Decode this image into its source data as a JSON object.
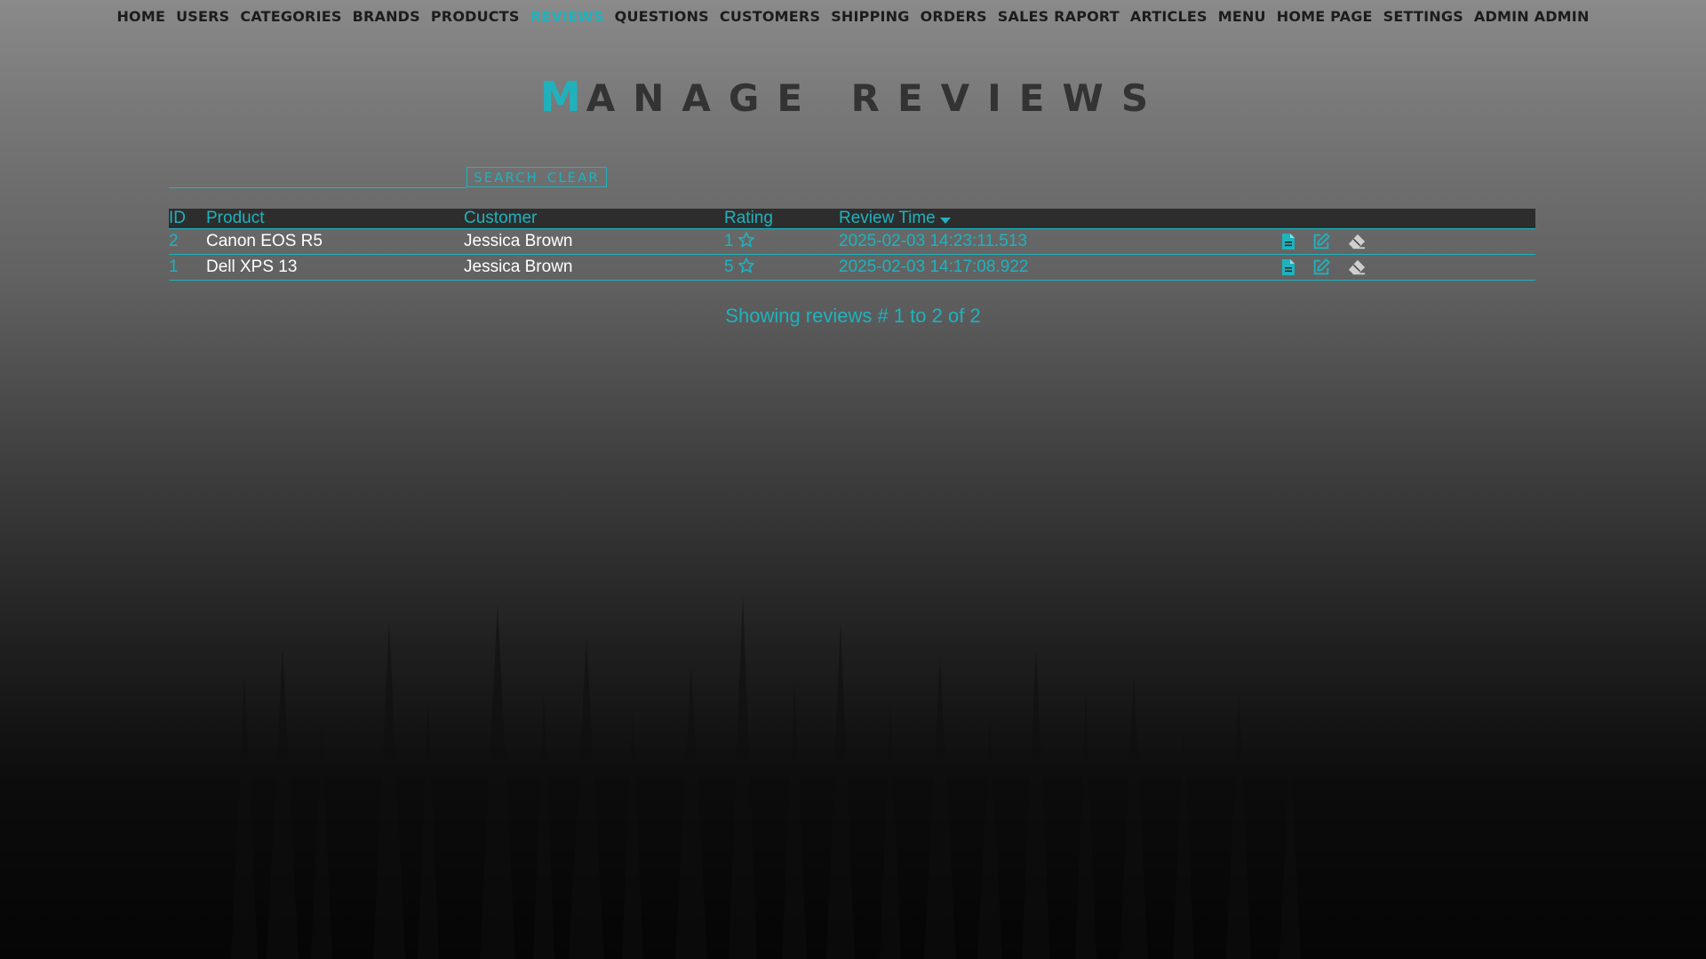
{
  "nav": {
    "items": [
      {
        "label": "HOME"
      },
      {
        "label": "USERS"
      },
      {
        "label": "CATEGORIES"
      },
      {
        "label": "BRANDS"
      },
      {
        "label": "PRODUCTS"
      },
      {
        "label": "REVIEWS"
      },
      {
        "label": "QUESTIONS"
      },
      {
        "label": "CUSTOMERS"
      },
      {
        "label": "SHIPPING"
      },
      {
        "label": "ORDERS"
      },
      {
        "label": "SALES RAPORT"
      },
      {
        "label": "ARTICLES"
      },
      {
        "label": "MENU"
      },
      {
        "label": "HOME PAGE"
      },
      {
        "label": "SETTINGS"
      },
      {
        "label": "ADMIN ADMIN"
      }
    ],
    "active": "REVIEWS"
  },
  "page": {
    "title_first": "M",
    "title_rest": "ANAGE REVIEWS"
  },
  "search": {
    "value": "",
    "placeholder": "",
    "search_label": "SEARCH",
    "clear_label": "CLEAR"
  },
  "table": {
    "headers": {
      "id": "ID",
      "product": "Product",
      "customer": "Customer",
      "rating": "Rating",
      "review_time": "Review Time"
    },
    "sort": {
      "column": "review_time",
      "direction": "desc"
    },
    "rows": [
      {
        "id": "2",
        "product": "Canon EOS R5",
        "customer": "Jessica Brown",
        "rating": "1",
        "time": "2025-02-03 14:23:11.513"
      },
      {
        "id": "1",
        "product": "Dell XPS 13",
        "customer": "Jessica Brown",
        "rating": "5",
        "time": "2025-02-03 14:17:08.922"
      }
    ],
    "row_actions": [
      "details-icon",
      "edit-icon",
      "eraser-icon"
    ]
  },
  "footer": {
    "showing": "Showing reviews # 1 to 2 of 2"
  },
  "colors": {
    "accent": "#1fb2bd",
    "nav_text": "#1c1c1c",
    "title_text": "#333333",
    "header_bg": "#2d2d2d",
    "delete_icon": "#bbbbbb"
  }
}
